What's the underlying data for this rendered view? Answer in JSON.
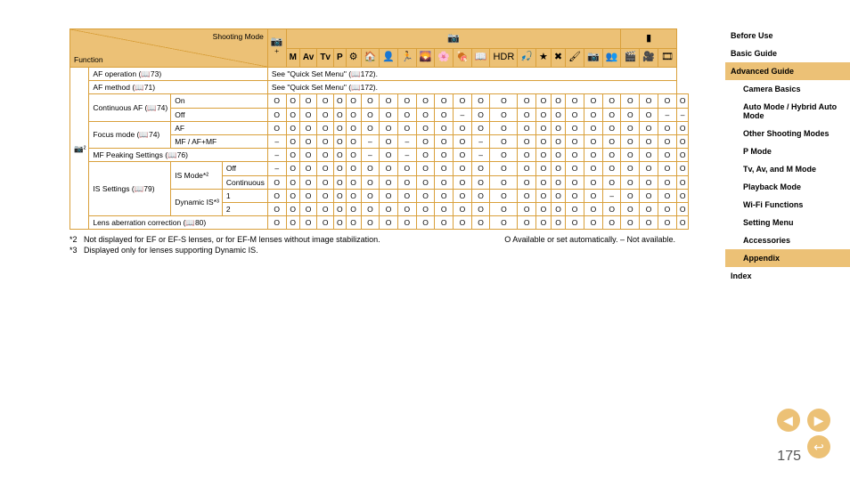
{
  "header": {
    "function": "Function",
    "shootingMode": "Shooting Mode"
  },
  "modeGroups": {
    "camera": "📷",
    "movie": "▮"
  },
  "modes": [
    "📷⁺",
    "M",
    "Av",
    "Tv",
    "P",
    "⚙",
    "🏠",
    "👤",
    "🏃",
    "🌄",
    "🌸",
    "🍖",
    "📖",
    "HDR",
    "🎣",
    "★",
    "✖",
    "🖌",
    "📷",
    "👥",
    "🎬",
    "🎥",
    "🎞"
  ],
  "rows": [
    {
      "label": "AF operation (📖73)",
      "see": "See \"Quick Set Menu\" (📖172)."
    },
    {
      "label": "AF method (📖71)",
      "see": "See \"Quick Set Menu\" (📖172)."
    },
    {
      "group": "Continuous AF (📖74)",
      "sub": "On",
      "cells": [
        "O",
        "O",
        "O",
        "O",
        "O",
        "O",
        "O",
        "O",
        "O",
        "O",
        "O",
        "O",
        "O",
        "O",
        "O",
        "O",
        "O",
        "O",
        "O",
        "O",
        "O",
        "O",
        "O",
        "O"
      ]
    },
    {
      "sub": "Off",
      "cells": [
        "O",
        "O",
        "O",
        "O",
        "O",
        "O",
        "O",
        "O",
        "O",
        "O",
        "O",
        "–",
        "O",
        "O",
        "O",
        "O",
        "O",
        "O",
        "O",
        "O",
        "O",
        "O",
        "–",
        "–"
      ]
    },
    {
      "group": "Focus mode (📖74)",
      "sub": "AF",
      "cells": [
        "O",
        "O",
        "O",
        "O",
        "O",
        "O",
        "O",
        "O",
        "O",
        "O",
        "O",
        "O",
        "O",
        "O",
        "O",
        "O",
        "O",
        "O",
        "O",
        "O",
        "O",
        "O",
        "O",
        "O"
      ]
    },
    {
      "sub": "MF / AF+MF",
      "cells": [
        "–",
        "O",
        "O",
        "O",
        "O",
        "O",
        "–",
        "O",
        "–",
        "O",
        "O",
        "O",
        "–",
        "O",
        "O",
        "O",
        "O",
        "O",
        "O",
        "O",
        "O",
        "O",
        "O",
        "O"
      ]
    },
    {
      "label": "MF Peaking Settings (📖76)",
      "cells": [
        "–",
        "O",
        "O",
        "O",
        "O",
        "O",
        "–",
        "O",
        "–",
        "O",
        "O",
        "O",
        "–",
        "O",
        "O",
        "O",
        "O",
        "O",
        "O",
        "O",
        "O",
        "O",
        "O",
        "O"
      ]
    },
    {
      "group": "IS Settings (📖79)",
      "g2": "IS Mode*²",
      "sub": "Off",
      "cells": [
        "–",
        "O",
        "O",
        "O",
        "O",
        "O",
        "O",
        "O",
        "O",
        "O",
        "O",
        "O",
        "O",
        "O",
        "O",
        "O",
        "O",
        "O",
        "O",
        "O",
        "O",
        "O",
        "O",
        "O"
      ]
    },
    {
      "sub": "Continuous",
      "cells": [
        "O",
        "O",
        "O",
        "O",
        "O",
        "O",
        "O",
        "O",
        "O",
        "O",
        "O",
        "O",
        "O",
        "O",
        "O",
        "O",
        "O",
        "O",
        "O",
        "O",
        "O",
        "O",
        "O",
        "O"
      ]
    },
    {
      "g2": "Dynamic IS*³",
      "sub": "1",
      "cells": [
        "O",
        "O",
        "O",
        "O",
        "O",
        "O",
        "O",
        "O",
        "O",
        "O",
        "O",
        "O",
        "O",
        "O",
        "O",
        "O",
        "O",
        "O",
        "O",
        "–",
        "O",
        "O",
        "O",
        "O"
      ]
    },
    {
      "sub": "2",
      "cells": [
        "O",
        "O",
        "O",
        "O",
        "O",
        "O",
        "O",
        "O",
        "O",
        "O",
        "O",
        "O",
        "O",
        "O",
        "O",
        "O",
        "O",
        "O",
        "O",
        "O",
        "O",
        "O",
        "O",
        "O"
      ]
    },
    {
      "label": "Lens aberration correction (📖80)",
      "cells": [
        "O",
        "O",
        "O",
        "O",
        "O",
        "O",
        "O",
        "O",
        "O",
        "O",
        "O",
        "O",
        "O",
        "O",
        "O",
        "O",
        "O",
        "O",
        "O",
        "O",
        "O",
        "O",
        "O",
        "O"
      ]
    }
  ],
  "leftIcon": "📷²",
  "footnotes": [
    {
      "num": "*2",
      "text": "Not displayed for EF or EF-S lenses, or for EF-M lenses without image stabilization."
    },
    {
      "num": "*3",
      "text": "Displayed only for lenses supporting Dynamic IS."
    }
  ],
  "legend": "O Available or set automatically. – Not available.",
  "nav": [
    {
      "label": "Before Use"
    },
    {
      "label": "Basic Guide"
    },
    {
      "label": "Advanced Guide",
      "sel": true
    },
    {
      "label": "Camera Basics",
      "sub": true
    },
    {
      "label": "Auto Mode / Hybrid Auto Mode",
      "sub": true
    },
    {
      "label": "Other Shooting Modes",
      "sub": true
    },
    {
      "label": "P Mode",
      "sub": true
    },
    {
      "label": "Tv, Av, and M Mode",
      "sub": true
    },
    {
      "label": "Playback Mode",
      "sub": true
    },
    {
      "label": "Wi-Fi Functions",
      "sub": true
    },
    {
      "label": "Setting Menu",
      "sub": true
    },
    {
      "label": "Accessories",
      "sub": true
    },
    {
      "label": "Appendix",
      "sub": true,
      "sel": true
    },
    {
      "label": "Index"
    }
  ],
  "pageNumber": "175",
  "btn": {
    "prev": "◀",
    "next": "▶",
    "return": "↩"
  }
}
